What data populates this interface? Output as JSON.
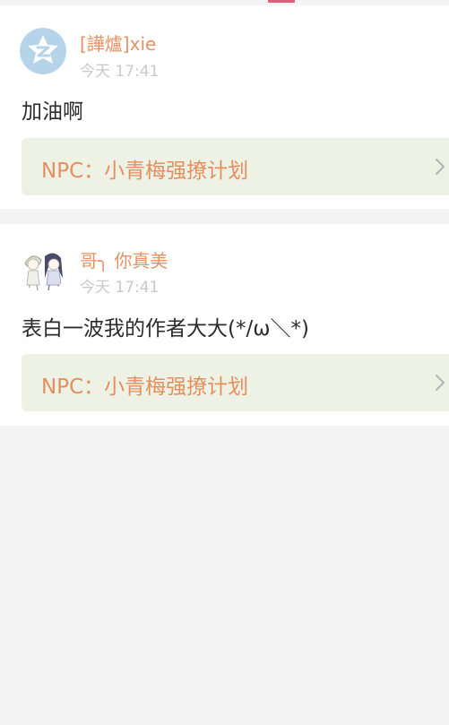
{
  "posts": [
    {
      "username": "[譁爐]xie",
      "time": "今天 17:41",
      "content": "加油啊",
      "book_link": "NPC：小青梅强撩计划"
    },
    {
      "username": "哥╮ 你真美",
      "time": "今天 17:41",
      "content": "表白一波我的作者大大(*/ω＼*)",
      "book_link": "NPC：小青梅强撩计划"
    }
  ],
  "colors": {
    "username": "#e39366",
    "timestamp": "#c9c9c9",
    "book_link_text": "#e38f5f",
    "book_link_bg": "#eef2e5",
    "page_bg": "#f4f4f4"
  },
  "icons": {
    "default_avatar": "qzone-star-avatar-icon",
    "user_avatar": "anime-couple-avatar",
    "chevron": "chevron-right-icon"
  }
}
